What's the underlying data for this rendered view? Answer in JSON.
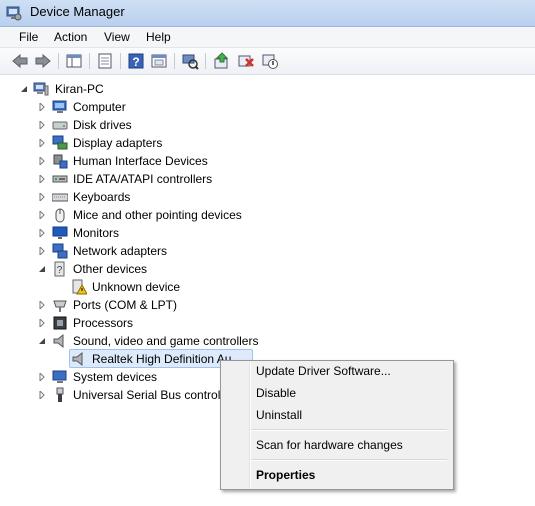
{
  "window": {
    "title": "Device Manager"
  },
  "menubar": {
    "items": [
      "File",
      "Action",
      "View",
      "Help"
    ]
  },
  "toolbar": {
    "buttons": [
      "back-icon",
      "forward-icon",
      "show-hide-console-tree-icon",
      "properties-icon",
      "help-icon",
      "scan-hardware-icon",
      "update-driver-icon",
      "uninstall-icon",
      "disable-icon"
    ]
  },
  "tree": {
    "root": "Kiran-PC",
    "items": [
      "Computer",
      "Disk drives",
      "Display adapters",
      "Human Interface Devices",
      "IDE ATA/ATAPI controllers",
      "Keyboards",
      "Mice and other pointing devices",
      "Monitors",
      "Network adapters",
      "Other devices",
      "Unknown device",
      "Ports (COM & LPT)",
      "Processors",
      "Sound, video and game controllers",
      "Realtek High Definition Au",
      "System devices",
      "Universal Serial Bus controlle"
    ]
  },
  "context_menu": {
    "update_driver": "Update Driver Software...",
    "disable": "Disable",
    "uninstall": "Uninstall",
    "scan": "Scan for hardware changes",
    "properties": "Properties"
  },
  "colors": {
    "selection": "#dceafb",
    "selection_border": "#9ec3ef",
    "menu_bg": "#f0f0f0"
  }
}
